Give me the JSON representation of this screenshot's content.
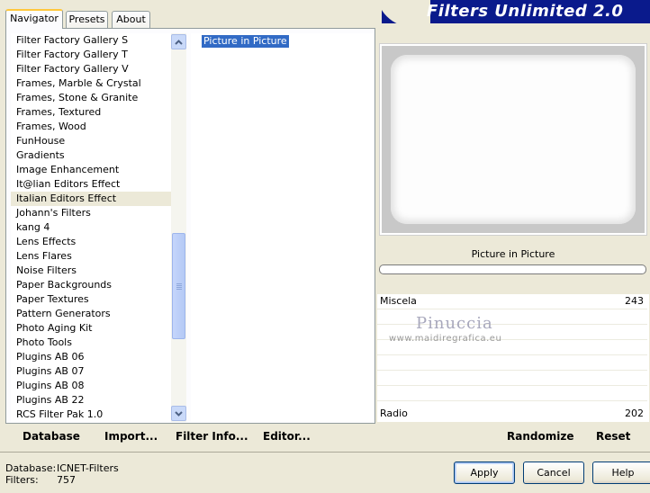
{
  "tabs": [
    {
      "label": "Navigator",
      "active": true
    },
    {
      "label": "Presets",
      "active": false
    },
    {
      "label": "About",
      "active": false
    }
  ],
  "banner_title": "Filters Unlimited 2.0",
  "categories": [
    "Filter Factory Gallery S",
    "Filter Factory Gallery T",
    "Filter Factory Gallery V",
    "Frames, Marble & Crystal",
    "Frames, Stone & Granite",
    "Frames, Textured",
    "Frames, Wood",
    "FunHouse",
    "Gradients",
    "Image Enhancement",
    "It@lian Editors Effect",
    "Italian Editors Effect",
    "Johann's Filters",
    "kang 4",
    "Lens Effects",
    "Lens Flares",
    "Noise Filters",
    "Paper Backgrounds",
    "Paper Textures",
    "Pattern Generators",
    "Photo Aging Kit",
    "Photo Tools",
    "Plugins AB 06",
    "Plugins AB 07",
    "Plugins AB 08",
    "Plugins AB 22",
    "RCS Filter Pak 1.0"
  ],
  "selected_category": "Italian Editors Effect",
  "filters": [
    "Picture in Picture"
  ],
  "selected_filter": "Picture in Picture",
  "nav_buttons": {
    "database": "Database",
    "import": "Import...",
    "filter_info": "Filter Info...",
    "editor": "Editor..."
  },
  "preview": {
    "filter_name": "Picture in Picture",
    "progress": 0
  },
  "params": [
    {
      "label": "Miscela",
      "value": "243"
    },
    {
      "label": "Radio",
      "value": "202"
    }
  ],
  "watermark": {
    "name": "Pinuccia",
    "url": "www.maidiregrafica.eu"
  },
  "preset_buttons": {
    "randomize": "Randomize",
    "reset": "Reset"
  },
  "status": {
    "database_label": "Database:",
    "database_value": "ICNET-Filters",
    "filters_label": "Filters:",
    "filters_value": "757"
  },
  "dialog_buttons": {
    "apply": "Apply",
    "cancel": "Cancel",
    "help": "Help"
  },
  "colors": {
    "banner": "#0a1a8c",
    "selection": "#316ac5",
    "tab_highlight": "#ffc83c"
  }
}
